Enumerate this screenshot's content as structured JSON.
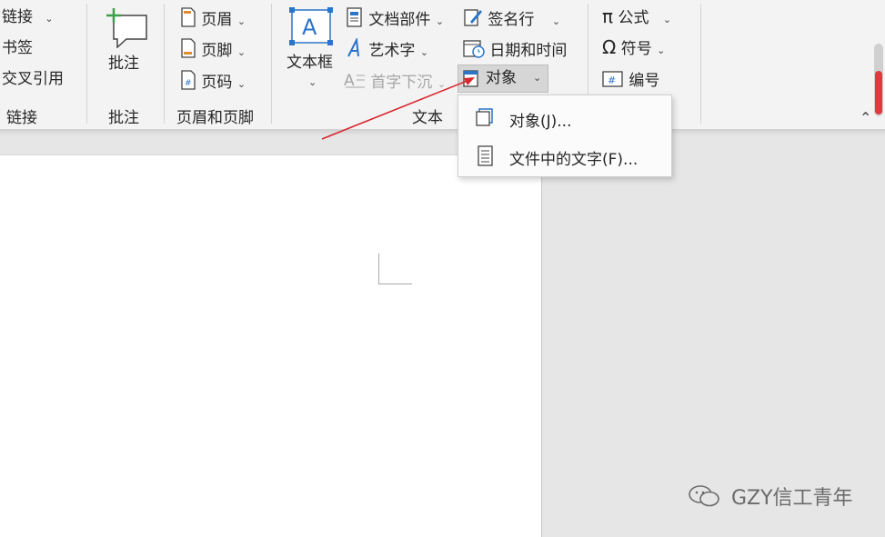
{
  "links_group": {
    "items": [
      {
        "label": "链接",
        "has_dropdown": true
      },
      {
        "label": "书签",
        "has_dropdown": false
      },
      {
        "label": "交叉引用",
        "has_dropdown": false
      }
    ],
    "group_label": "链接"
  },
  "comments_group": {
    "button_label": "批注",
    "group_label": "批注"
  },
  "header_footer_group": {
    "items": [
      {
        "label": "页眉",
        "icon": "header-icon"
      },
      {
        "label": "页脚",
        "icon": "footer-icon"
      },
      {
        "label": "页码",
        "icon": "page-number-icon"
      }
    ],
    "group_label": "页眉和页脚"
  },
  "text_group": {
    "textbox_label": "文本框",
    "quick_parts_label": "文档部件",
    "wordart_label": "艺术字",
    "dropcap_label": "首字下沉",
    "signature_label": "签名行",
    "datetime_label": "日期和时间",
    "object_label": "对象",
    "group_label": "文本"
  },
  "symbols_group": {
    "equation_label": "公式",
    "symbol_label": "符号",
    "numbering_label": "编号"
  },
  "object_menu": {
    "items": [
      {
        "label": "对象(J)...",
        "icon": "object-icon"
      },
      {
        "label": "文件中的文字(F)...",
        "icon": "text-from-file-icon"
      }
    ]
  },
  "watermark": {
    "text": "GZY信工青年"
  },
  "colors": {
    "accent_blue": "#2b74c7",
    "annotation_arrow": "#d9262c",
    "scrollbar_red": "#e0393e",
    "comment_plus_green": "#3aa14a"
  }
}
